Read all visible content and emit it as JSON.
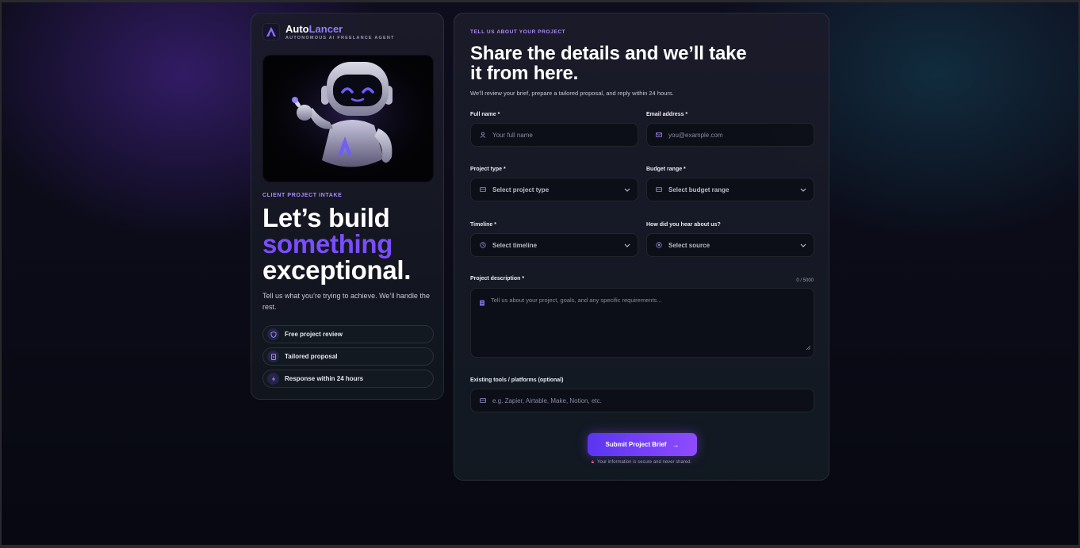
{
  "brand": {
    "name_part1": "Auto",
    "name_part2": "Lancer",
    "tagline": "AUTONOMOUS AI FREELANCE AGENT"
  },
  "left": {
    "eyebrow": "CLIENT PROJECT INTAKE",
    "hero_line1": "Let’s build",
    "hero_line2": "something",
    "hero_line3": "exceptional.",
    "subtitle": "Tell us what you’re trying to achieve. We’ll handle the rest.",
    "features": [
      {
        "label": "Free project review",
        "icon": "shield-icon"
      },
      {
        "label": "Tailored proposal",
        "icon": "document-icon"
      },
      {
        "label": "Response within 24 hours",
        "icon": "bolt-icon"
      }
    ]
  },
  "form": {
    "eyebrow": "TELL US ABOUT YOUR PROJECT",
    "title": "Share the details and we’ll take it from here.",
    "subtitle": "We’ll review your brief, prepare a tailored proposal, and reply within 24 hours.",
    "full_name": {
      "label": "Full name *",
      "placeholder": "Your full name",
      "icon": "user-icon"
    },
    "email": {
      "label": "Email address *",
      "placeholder": "you@example.com",
      "icon": "mail-icon"
    },
    "project_type": {
      "label": "Project type *",
      "value": "Select project type",
      "icon": "grid-icon"
    },
    "budget": {
      "label": "Budget range *",
      "value": "Select budget range",
      "icon": "wallet-icon"
    },
    "timeline": {
      "label": "Timeline *",
      "value": "Select timeline",
      "icon": "clock-icon"
    },
    "source": {
      "label": "How did you hear about us?",
      "value": "Select source",
      "icon": "target-icon"
    },
    "description": {
      "label": "Project description *",
      "counter": "0 / 5000",
      "placeholder": "Tell us about your project, goals, and any specific requirements..."
    },
    "tools": {
      "label": "Existing tools / platforms (optional)",
      "placeholder": "e.g. Zapier, Airtable, Make, Notion, etc."
    },
    "submit_label": "Submit Project Brief",
    "secure_note": "Your information is secure and never shared."
  },
  "colors": {
    "accent": "#7a4dff",
    "eyebrow": "#a98bff",
    "button_start": "#5b35f0",
    "button_end": "#8f4bff"
  }
}
